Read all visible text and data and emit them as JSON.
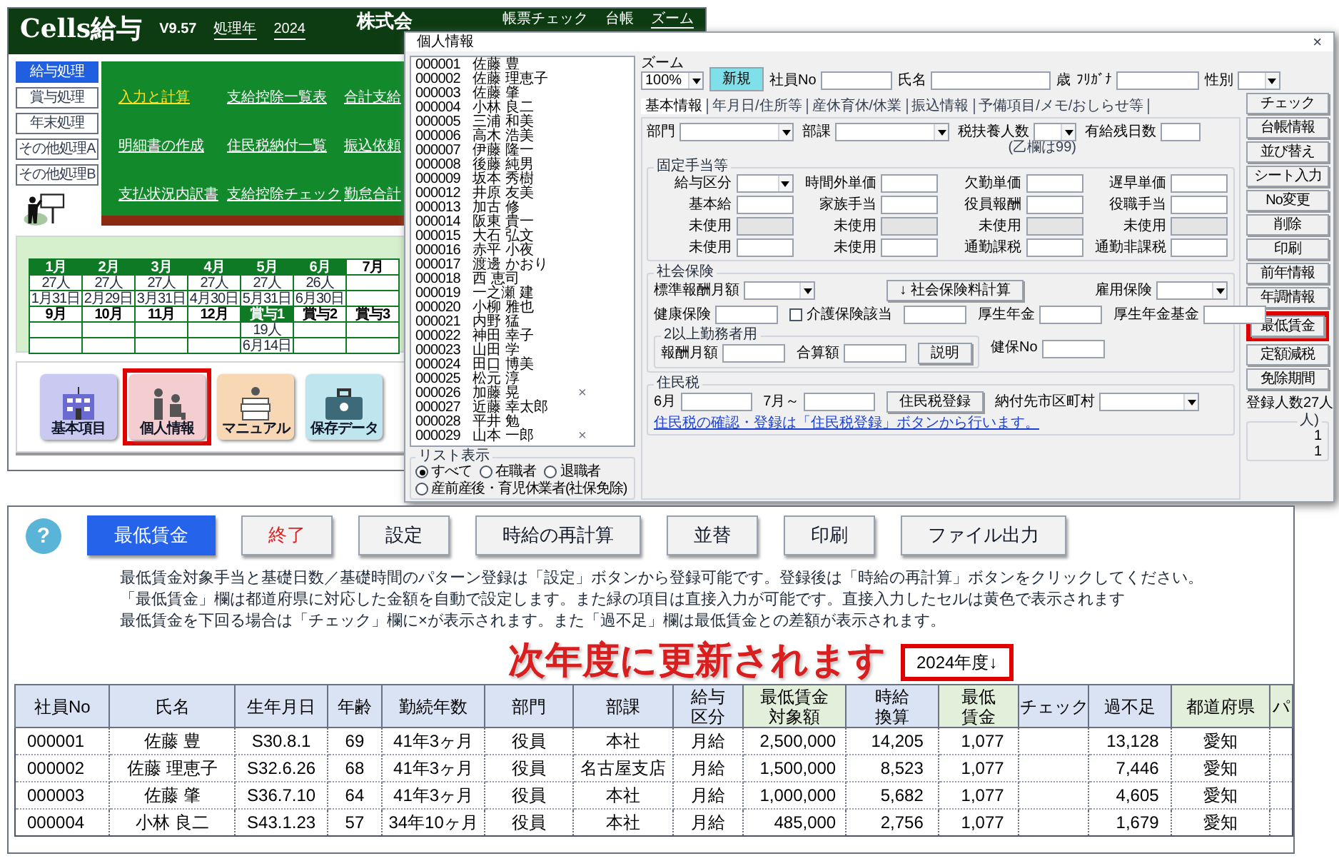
{
  "app": {
    "title": "Cells給与",
    "version": "V9.57",
    "year_label": "処理年",
    "year": "2024",
    "company": "株式会",
    "header_links": [
      "帳票チェック",
      "台帳",
      "ズーム"
    ]
  },
  "side_nav": [
    {
      "label": "給与処理",
      "selected": true
    },
    {
      "label": "賞与処理",
      "selected": false
    },
    {
      "label": "年末処理",
      "selected": false
    },
    {
      "label": "その他処理A",
      "selected": false
    },
    {
      "label": "その他処理B",
      "selected": false
    }
  ],
  "menu_links": [
    {
      "label": "入力と計算",
      "selected": true
    },
    {
      "label": "支給控除一覧表",
      "selected": false
    },
    {
      "label": "合計支給",
      "selected": false
    },
    {
      "label": "明細書の作成",
      "selected": false
    },
    {
      "label": "住民税納付一覧",
      "selected": false
    },
    {
      "label": "振込依頼",
      "selected": false
    },
    {
      "label": "支払状況内訳書",
      "selected": false
    },
    {
      "label": "支給控除チェック",
      "selected": false
    },
    {
      "label": "勤怠合計",
      "selected": false
    }
  ],
  "calendar": {
    "rows": [
      {
        "cells": [
          {
            "label": "1月",
            "done": true,
            "count": "27人",
            "date": "1月31日"
          },
          {
            "label": "2月",
            "done": true,
            "count": "27人",
            "date": "2月29日"
          },
          {
            "label": "3月",
            "done": true,
            "count": "27人",
            "date": "3月31日"
          },
          {
            "label": "4月",
            "done": true,
            "count": "27人",
            "date": "4月30日"
          },
          {
            "label": "5月",
            "done": true,
            "count": "27人",
            "date": "5月31日"
          },
          {
            "label": "6月",
            "done": true,
            "count": "26人",
            "date": "6月30日"
          },
          {
            "label": "7月",
            "done": false
          }
        ]
      },
      {
        "cells": [
          {
            "label": "9月",
            "done": false
          },
          {
            "label": "10月",
            "done": false
          },
          {
            "label": "11月",
            "done": false
          },
          {
            "label": "12月",
            "done": false
          },
          {
            "label": "賞与1",
            "done": true,
            "count": "19人",
            "date": "6月14日"
          },
          {
            "label": "賞与2",
            "done": false
          },
          {
            "label": "賞与3",
            "done": false
          }
        ]
      }
    ]
  },
  "tiles": [
    {
      "label": "基本項目",
      "kind": "building",
      "highlighted": false
    },
    {
      "label": "個人情報",
      "kind": "people",
      "highlighted": true
    },
    {
      "label": "マニュアル",
      "kind": "manual",
      "highlighted": false
    },
    {
      "label": "保存データ",
      "kind": "briefcase",
      "highlighted": false
    }
  ],
  "dialog": {
    "title": "個人情報",
    "close": "×",
    "employees": [
      {
        "no": "000001",
        "name": "佐藤 豊"
      },
      {
        "no": "000002",
        "name": "佐藤 理恵子"
      },
      {
        "no": "000003",
        "name": "佐藤 肇"
      },
      {
        "no": "000004",
        "name": "小林 良二"
      },
      {
        "no": "000005",
        "name": "三浦 和美"
      },
      {
        "no": "000006",
        "name": "高木 浩美"
      },
      {
        "no": "000007",
        "name": "伊藤 隆一"
      },
      {
        "no": "000008",
        "name": "後藤 純男"
      },
      {
        "no": "000009",
        "name": "坂本 秀樹"
      },
      {
        "no": "000012",
        "name": "井原 友美"
      },
      {
        "no": "000013",
        "name": "加古 修"
      },
      {
        "no": "000014",
        "name": "阪東 貴一"
      },
      {
        "no": "000015",
        "name": "大石 弘文"
      },
      {
        "no": "000016",
        "name": "赤平 小夜"
      },
      {
        "no": "000017",
        "name": "渡邊 かおり"
      },
      {
        "no": "000018",
        "name": "西 恵司"
      },
      {
        "no": "000019",
        "name": "一之瀬 建"
      },
      {
        "no": "000020",
        "name": "小柳 雅也"
      },
      {
        "no": "000021",
        "name": "内野 猛"
      },
      {
        "no": "000022",
        "name": "神田 幸子"
      },
      {
        "no": "000023",
        "name": "山田 学"
      },
      {
        "no": "000024",
        "name": "田口 博美"
      },
      {
        "no": "000025",
        "name": "松元 淳"
      },
      {
        "no": "000026",
        "name": "加藤 晃",
        "mark": "×"
      },
      {
        "no": "000027",
        "name": "近藤 幸太郎"
      },
      {
        "no": "000028",
        "name": "平井 勉"
      },
      {
        "no": "000029",
        "name": "山本 一郎",
        "mark": "×"
      }
    ],
    "list_filter": {
      "title": "リスト表示",
      "options": [
        {
          "label": "すべて",
          "selected": true
        },
        {
          "label": "在職者",
          "selected": false
        },
        {
          "label": "退職者",
          "selected": false
        },
        {
          "label": "産前産後・育児休業者(社保免除)",
          "selected": false
        }
      ]
    },
    "zoom": {
      "label": "ズーム",
      "value": "100%"
    },
    "new_button": "新規",
    "header_fields": [
      {
        "kind": "input",
        "label": "社員No"
      },
      {
        "kind": "input",
        "label": "氏名"
      },
      {
        "kind": "text",
        "label": "歳"
      },
      {
        "kind": "input",
        "label": "ﾌﾘｶﾞﾅ"
      },
      {
        "kind": "select",
        "label": "性別"
      }
    ],
    "tabs": [
      {
        "label": "基本情報",
        "selected": true
      },
      {
        "label": "年月日/住所等",
        "selected": false
      },
      {
        "label": "産休育休/休業",
        "selected": false
      },
      {
        "label": "振込情報",
        "selected": false
      },
      {
        "label": "予備項目/メモ/おしらせ等",
        "selected": false
      }
    ],
    "top_fields": [
      {
        "kind": "select",
        "label": "部門"
      },
      {
        "kind": "select",
        "label": "部課"
      },
      {
        "kind": "select",
        "label": "税扶養人数",
        "note": "(乙欄は99)"
      },
      {
        "kind": "input",
        "label": "有給残日数"
      }
    ],
    "allowances": {
      "title": "固定手当等",
      "fields": [
        {
          "kind": "select",
          "label": "給与区分",
          "disabled": false
        },
        {
          "kind": "input",
          "label": "時間外単価",
          "disabled": false
        },
        {
          "kind": "input",
          "label": "欠勤単価",
          "disabled": false
        },
        {
          "kind": "input",
          "label": "遅早単価",
          "disabled": false
        },
        {
          "kind": "input",
          "label": "基本給",
          "disabled": false
        },
        {
          "kind": "input",
          "label": "家族手当",
          "disabled": false
        },
        {
          "kind": "input",
          "label": "役員報酬",
          "disabled": false
        },
        {
          "kind": "input",
          "label": "役職手当",
          "disabled": false
        },
        {
          "kind": "input",
          "label": "未使用",
          "disabled": true
        },
        {
          "kind": "input",
          "label": "未使用",
          "disabled": true
        },
        {
          "kind": "input",
          "label": "未使用",
          "disabled": true
        },
        {
          "kind": "input",
          "label": "未使用",
          "disabled": true
        },
        {
          "kind": "input",
          "label": "未使用",
          "disabled": false
        },
        {
          "kind": "input",
          "label": "未使用",
          "disabled": false
        },
        {
          "kind": "input",
          "label": "通勤課税",
          "disabled": false
        },
        {
          "kind": "input",
          "label": "通勤非課税",
          "disabled": false
        }
      ]
    },
    "social_insurance": {
      "title": "社会保険",
      "rows": [
        [
          {
            "kind": "select",
            "label": "標準報酬月額"
          },
          {
            "kind": "button",
            "label": "↓ 社会保険料計算"
          },
          {
            "kind": "select",
            "label": "雇用保険"
          }
        ],
        [
          {
            "kind": "input",
            "label": "健康保険"
          },
          {
            "kind": "checkbox",
            "label": "介護保険該当",
            "checked": false
          },
          {
            "kind": "input"
          },
          {
            "kind": "input",
            "label": "厚生年金"
          },
          {
            "kind": "input",
            "label": "厚生年金基金"
          }
        ],
        [
          {
            "kind": "group",
            "title": "2以上勤務者用",
            "items": [
              {
                "kind": "input",
                "label": "報酬月額"
              },
              {
                "kind": "input",
                "label": "合算額"
              },
              {
                "kind": "button",
                "label": "説明"
              }
            ]
          },
          {
            "kind": "input",
            "label": "健保No"
          }
        ]
      ]
    },
    "resident_tax": {
      "title": "住民税",
      "items": [
        {
          "kind": "input",
          "label": "6月"
        },
        {
          "kind": "input",
          "label": "7月～"
        },
        {
          "kind": "button",
          "label": "住民税登録"
        },
        {
          "kind": "select",
          "label": "納付先市区町村"
        }
      ],
      "note": "住民税の確認・登録は「住民税登録」ボタンから行います。"
    },
    "side_buttons": [
      {
        "label": "チェック",
        "highlighted": false
      },
      {
        "label": "台帳情報",
        "highlighted": false
      },
      {
        "label": "並び替え",
        "highlighted": false
      },
      {
        "label": "シート入力",
        "highlighted": false
      },
      {
        "label": "No変更",
        "highlighted": false
      },
      {
        "label": "削除",
        "highlighted": false
      },
      {
        "label": "印刷",
        "highlighted": false
      },
      {
        "label": "前年情報",
        "highlighted": false
      },
      {
        "label": "年調情報",
        "highlighted": false
      },
      {
        "label": "最低賃金",
        "highlighted": true
      },
      {
        "label": "定額減税",
        "highlighted": false
      },
      {
        "label": "免除期間",
        "highlighted": false
      }
    ],
    "count_label": "登録人数",
    "count": "27人",
    "summary_box": {
      "title": "人)",
      "values": [
        "1",
        "1"
      ]
    }
  },
  "panel": {
    "help": "?",
    "buttons": [
      {
        "label": "最低賃金",
        "selected": true,
        "kind": "normal"
      },
      {
        "label": "終了",
        "selected": false,
        "kind": "exit"
      },
      {
        "label": "設定",
        "selected": false,
        "kind": "normal"
      },
      {
        "label": "時給の再計算",
        "selected": false,
        "kind": "normal"
      },
      {
        "label": "並替",
        "selected": false,
        "kind": "normal"
      },
      {
        "label": "印刷",
        "selected": false,
        "kind": "normal"
      },
      {
        "label": "ファイル出力",
        "selected": false,
        "kind": "normal"
      }
    ],
    "notes": [
      "最低賃金対象手当と基礎日数／基礎時間のパターン登録は「設定」ボタンから登録可能です。登録後は「時給の再計算」ボタンをクリックしてください。",
      "「最低賃金」欄は都道府県に対応した金額を自動で設定します。また緑の項目は直接入力が可能です。直接入力したセルは黄色で表示されます",
      "最低賃金を下回る場合は「チェック」欄に×が表示されます。また「過不足」欄は最低賃金との差額が表示されます。"
    ],
    "banner": "次年度に更新されます",
    "year": "2024年度↓",
    "table": {
      "columns": [
        {
          "lines": [
            "社員No"
          ],
          "color": "#dae3f3"
        },
        {
          "lines": [
            "氏名"
          ],
          "color": "#dae3f3"
        },
        {
          "lines": [
            "生年月日"
          ],
          "color": "#dae3f3"
        },
        {
          "lines": [
            "年齢"
          ],
          "color": "#dae3f3"
        },
        {
          "lines": [
            "勤続年数"
          ],
          "color": "#dae3f3"
        },
        {
          "lines": [
            "部門"
          ],
          "color": "#dae3f3"
        },
        {
          "lines": [
            "部課"
          ],
          "color": "#dae3f3"
        },
        {
          "lines": [
            "給与",
            "区分"
          ],
          "color": "#dae3f3"
        },
        {
          "lines": [
            "最低賃金",
            "対象額"
          ],
          "color": "#e2efda"
        },
        {
          "lines": [
            "時給",
            "換算"
          ],
          "color": "#dae3f3"
        },
        {
          "lines": [
            "最低",
            "賃金"
          ],
          "color": "#e2efda"
        },
        {
          "lines": [
            "チェック"
          ],
          "color": "#dae3f3"
        },
        {
          "lines": [
            "過不足"
          ],
          "color": "#dae3f3"
        },
        {
          "lines": [
            "都道府県"
          ],
          "color": "#e2efda"
        },
        {
          "lines": [
            "パ"
          ],
          "color": "#e2efda"
        }
      ],
      "rows": [
        [
          "000001",
          "佐藤 豊",
          "S30.8.1",
          "69",
          "41年3ヶ月",
          "役員",
          "本社",
          "月給",
          "2,500,000",
          "14,205",
          "1,077",
          null,
          "13,128",
          "愛知",
          null
        ],
        [
          "000002",
          "佐藤 理恵子",
          "S32.6.26",
          "68",
          "41年3ヶ月",
          "役員",
          "名古屋支店",
          "月給",
          "1,500,000",
          "8,523",
          "1,077",
          null,
          "7,446",
          "愛知",
          null
        ],
        [
          "000003",
          "佐藤 肇",
          "S36.7.10",
          "64",
          "41年3ヶ月",
          "役員",
          "本社",
          "月給",
          "1,000,000",
          "5,682",
          "1,077",
          null,
          "4,605",
          "愛知",
          null
        ],
        [
          "000004",
          "小林 良二",
          "S43.1.23",
          "57",
          "34年10ヶ月",
          "役員",
          "本社",
          "月給",
          "485,000",
          "2,756",
          "1,077",
          null,
          "1,679",
          "愛知",
          null
        ]
      ]
    }
  }
}
